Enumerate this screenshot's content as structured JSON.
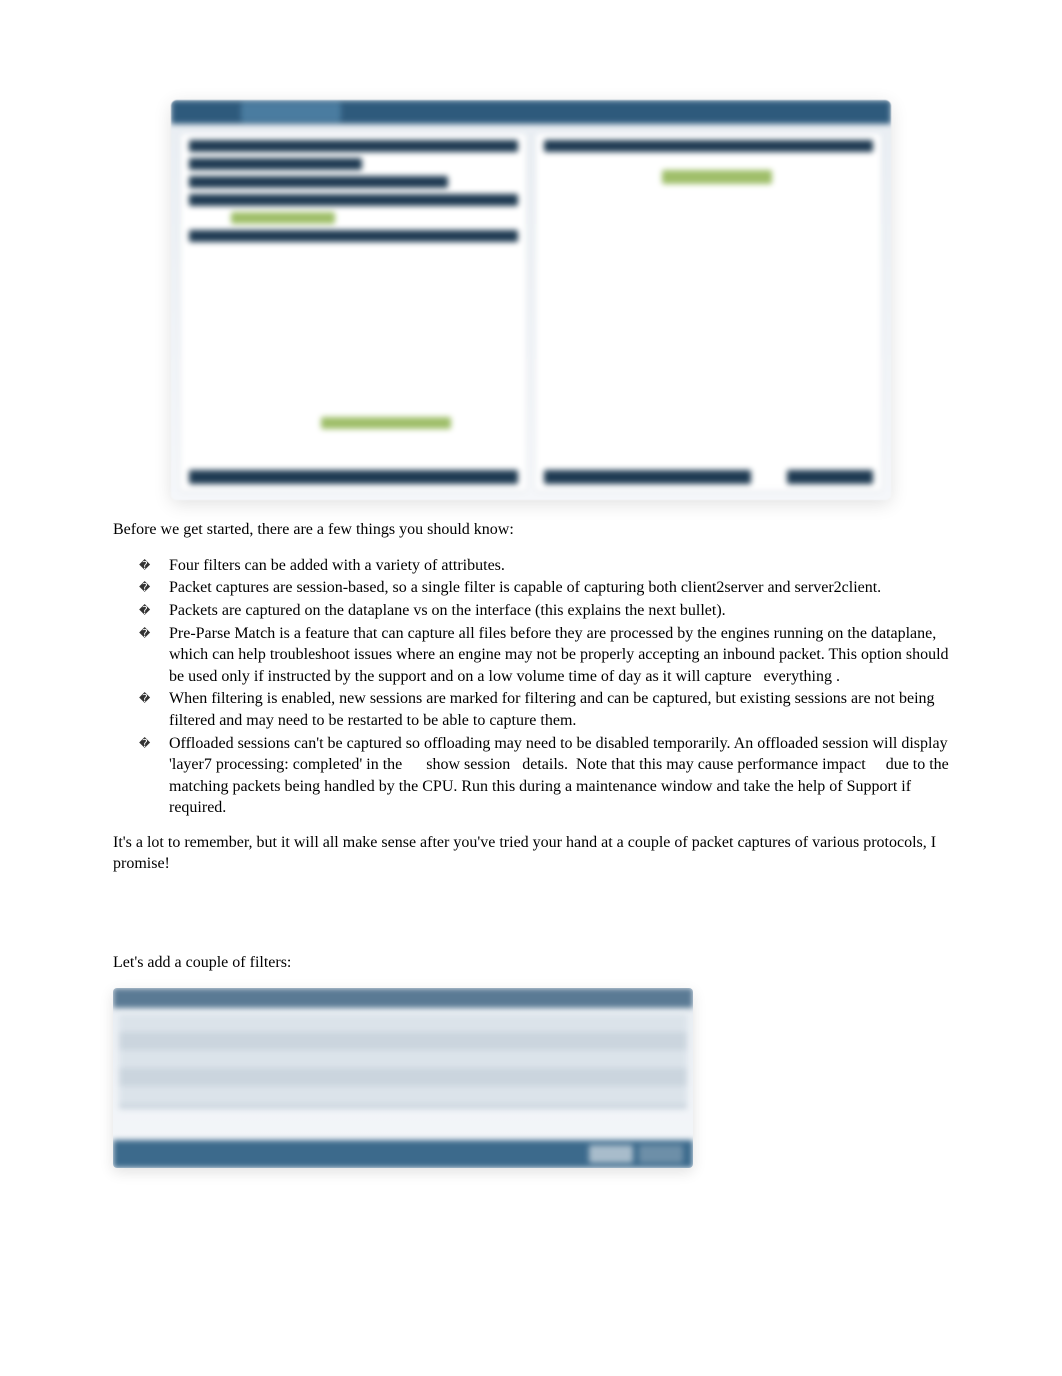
{
  "intro": "Before we get started, there are a few things you should know:",
  "bullets": [
    "Four filters can be added with a variety of attributes.",
    "Packet captures are session-based, so a single filter is capable of capturing both client2server and server2client.",
    "Packets are captured on the dataplane vs on the interface (this explains the next bullet).",
    "Pre-Parse Match is a feature that can capture all files before they are processed by the engines running on the dataplane, which can help troubleshoot issues where an engine may not be properly accepting an inbound packet. This option should be used only if instructed by the support and on a low volume time of day as it will capture   everything .",
    "When filtering is enabled, new sessions are marked for filtering and can be captured, but existing sessions are not being filtered and may need to be restarted to be able to capture them.",
    "Offloaded sessions can't be captured so offloading may need to be disabled temporarily. An offloaded session will display 'layer7 processing: completed' in the      show session   details.  Note that this may cause performance impact     due to the matching packets being handled by the CPU. Run this during a maintenance window and take the help of Support if required."
  ],
  "outro": "It's a lot to remember, but it will all make sense after you've tried your hand at a couple of packet captures of various protocols, I promise!",
  "filters_lead": "Let's add a couple of filters:"
}
